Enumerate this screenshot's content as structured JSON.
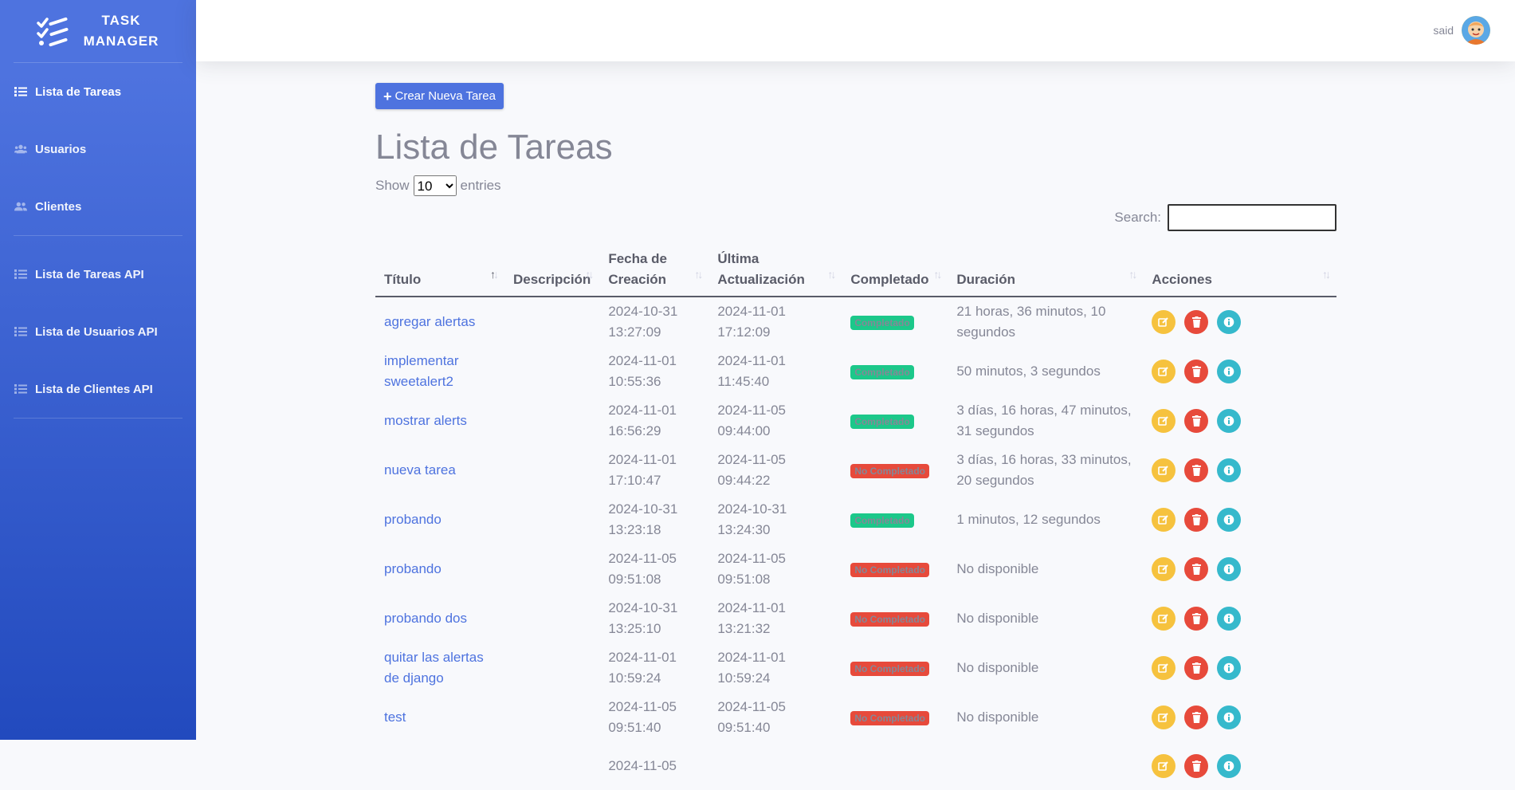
{
  "brand": {
    "line1": "TASK",
    "line2": "MANAGER"
  },
  "sidebar": {
    "items": [
      {
        "label": "Lista de Tareas",
        "icon": "list-icon"
      },
      {
        "label": "Usuarios",
        "icon": "users-icon"
      },
      {
        "label": "Clientes",
        "icon": "users-icon"
      },
      {
        "label": "Lista de Tareas API",
        "icon": "list-icon"
      },
      {
        "label": "Lista de Usuarios API",
        "icon": "list-icon"
      },
      {
        "label": "Lista de Clientes API",
        "icon": "list-icon"
      }
    ]
  },
  "user": {
    "name": "said"
  },
  "actions": {
    "create_label": "Crear Nueva Tarea"
  },
  "page": {
    "title": "Lista de Tareas"
  },
  "datatable": {
    "show_label": "Show",
    "entries_label": "entries",
    "page_size": "10",
    "search_label": "Search:"
  },
  "table": {
    "headers": [
      "Título",
      "Descripción",
      "Fecha de Creación",
      "Última Actualización",
      "Completado",
      "Duración",
      "Acciones"
    ],
    "rows": [
      {
        "title": "agregar alertas",
        "description": "",
        "created": "2024-10-31 13:27:09",
        "updated": "2024-11-01 17:12:09",
        "status": "Completado",
        "done": true,
        "duration": "21 horas, 36 minutos, 10 segundos"
      },
      {
        "title": "implementar sweetalert2",
        "description": "",
        "created": "2024-11-01 10:55:36",
        "updated": "2024-11-01 11:45:40",
        "status": "Completado",
        "done": true,
        "duration": "50 minutos, 3 segundos"
      },
      {
        "title": "mostrar alerts",
        "description": "",
        "created": "2024-11-01 16:56:29",
        "updated": "2024-11-05 09:44:00",
        "status": "Completado",
        "done": true,
        "duration": "3 días, 16 horas, 47 minutos, 31 segundos"
      },
      {
        "title": "nueva tarea",
        "description": "",
        "created": "2024-11-01 17:10:47",
        "updated": "2024-11-05 09:44:22",
        "status": "No Completado",
        "done": false,
        "duration": "3 días, 16 horas, 33 minutos, 20 segundos"
      },
      {
        "title": "probando",
        "description": "",
        "created": "2024-10-31 13:23:18",
        "updated": "2024-10-31 13:24:30",
        "status": "Completado",
        "done": true,
        "duration": "1 minutos, 12 segundos"
      },
      {
        "title": "probando",
        "description": "",
        "created": "2024-11-05 09:51:08",
        "updated": "2024-11-05 09:51:08",
        "status": "No Completado",
        "done": false,
        "duration": "No disponible"
      },
      {
        "title": "probando dos",
        "description": "",
        "created": "2024-10-31 13:25:10",
        "updated": "2024-11-01 13:21:32",
        "status": "No Completado",
        "done": false,
        "duration": "No disponible"
      },
      {
        "title": "quitar las alertas de django",
        "description": "",
        "created": "2024-11-01 10:59:24",
        "updated": "2024-11-01 10:59:24",
        "status": "No Completado",
        "done": false,
        "duration": "No disponible"
      },
      {
        "title": "test",
        "description": "",
        "created": "2024-11-05 09:51:40",
        "updated": "2024-11-05 09:51:40",
        "status": "No Completado",
        "done": false,
        "duration": "No disponible"
      },
      {
        "title": "",
        "description": "",
        "created": "2024-11-05",
        "updated": "",
        "status": "",
        "done": false,
        "duration": ""
      }
    ]
  },
  "colors": {
    "primary": "#4e73df",
    "success": "#1cc88a",
    "danger": "#e74a3b",
    "warning": "#f6c23e",
    "info": "#36b9cc"
  }
}
